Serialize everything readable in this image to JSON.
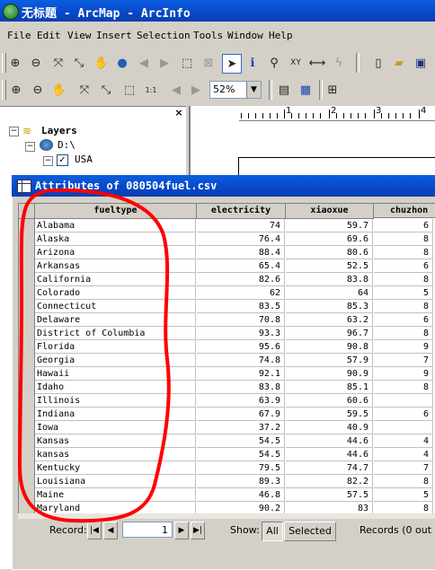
{
  "window": {
    "title": "无标题 - ArcMap - ArcInfo",
    "icon": "arcmap-globe-icon"
  },
  "menu": [
    "File",
    "Edit",
    "View",
    "Insert",
    "Selection",
    "Tools",
    "Window",
    "Help"
  ],
  "toolbar": {
    "zoom_value": "52%"
  },
  "toc": {
    "root_label": "Layers",
    "drive_label": "D:\\",
    "layer_label": "USA"
  },
  "ruler": {
    "marks": [
      "1",
      "2",
      "3",
      "4"
    ]
  },
  "attributes": {
    "title": "Attributes of 080504fuel.csv",
    "columns": [
      "fueltype",
      "electricity",
      "xiaoxue",
      "chuzhon"
    ],
    "rows": [
      [
        "Alabama",
        "74",
        "59.7",
        "6"
      ],
      [
        "Alaska",
        "76.4",
        "69.6",
        "8"
      ],
      [
        "Arizona",
        "88.4",
        "80.6",
        "8"
      ],
      [
        "Arkansas",
        "65.4",
        "52.5",
        "6"
      ],
      [
        "California",
        "82.6",
        "83.8",
        "8"
      ],
      [
        "Colorado",
        "62",
        "64",
        "5"
      ],
      [
        "Connecticut",
        "83.5",
        "85.3",
        "8"
      ],
      [
        "Delaware",
        "70.8",
        "63.2",
        "6"
      ],
      [
        "District of Columbia",
        "93.3",
        "96.7",
        "8"
      ],
      [
        "Florida",
        "95.6",
        "90.8",
        "9"
      ],
      [
        "Georgia",
        "74.8",
        "57.9",
        "7"
      ],
      [
        "Hawaii",
        "92.1",
        "90.9",
        "9"
      ],
      [
        "Idaho",
        "83.8",
        "85.1",
        "8"
      ],
      [
        "Illinois",
        "63.9",
        "60.6",
        ""
      ],
      [
        "Indiana",
        "67.9",
        "59.5",
        "6"
      ],
      [
        "Iowa",
        "37.2",
        "40.9",
        ""
      ],
      [
        "Kansas",
        "54.5",
        "44.6",
        "4"
      ],
      [
        "kansas",
        "54.5",
        "44.6",
        "4"
      ],
      [
        "Kentucky",
        "79.5",
        "74.7",
        "7"
      ],
      [
        "Louisiana",
        "89.3",
        "82.2",
        "8"
      ],
      [
        "Maine",
        "46.8",
        "57.5",
        "5"
      ],
      [
        "Maryland",
        "90.2",
        "83",
        "8"
      ]
    ],
    "status": {
      "record_label": "Record:",
      "record_value": "1",
      "show_label": "Show:",
      "all_label": "All",
      "selected_label": "Selected",
      "records_text": "Records (0 out of"
    }
  },
  "annotation": {
    "color": "#ff0000",
    "shape": "hand-drawn-circle"
  }
}
